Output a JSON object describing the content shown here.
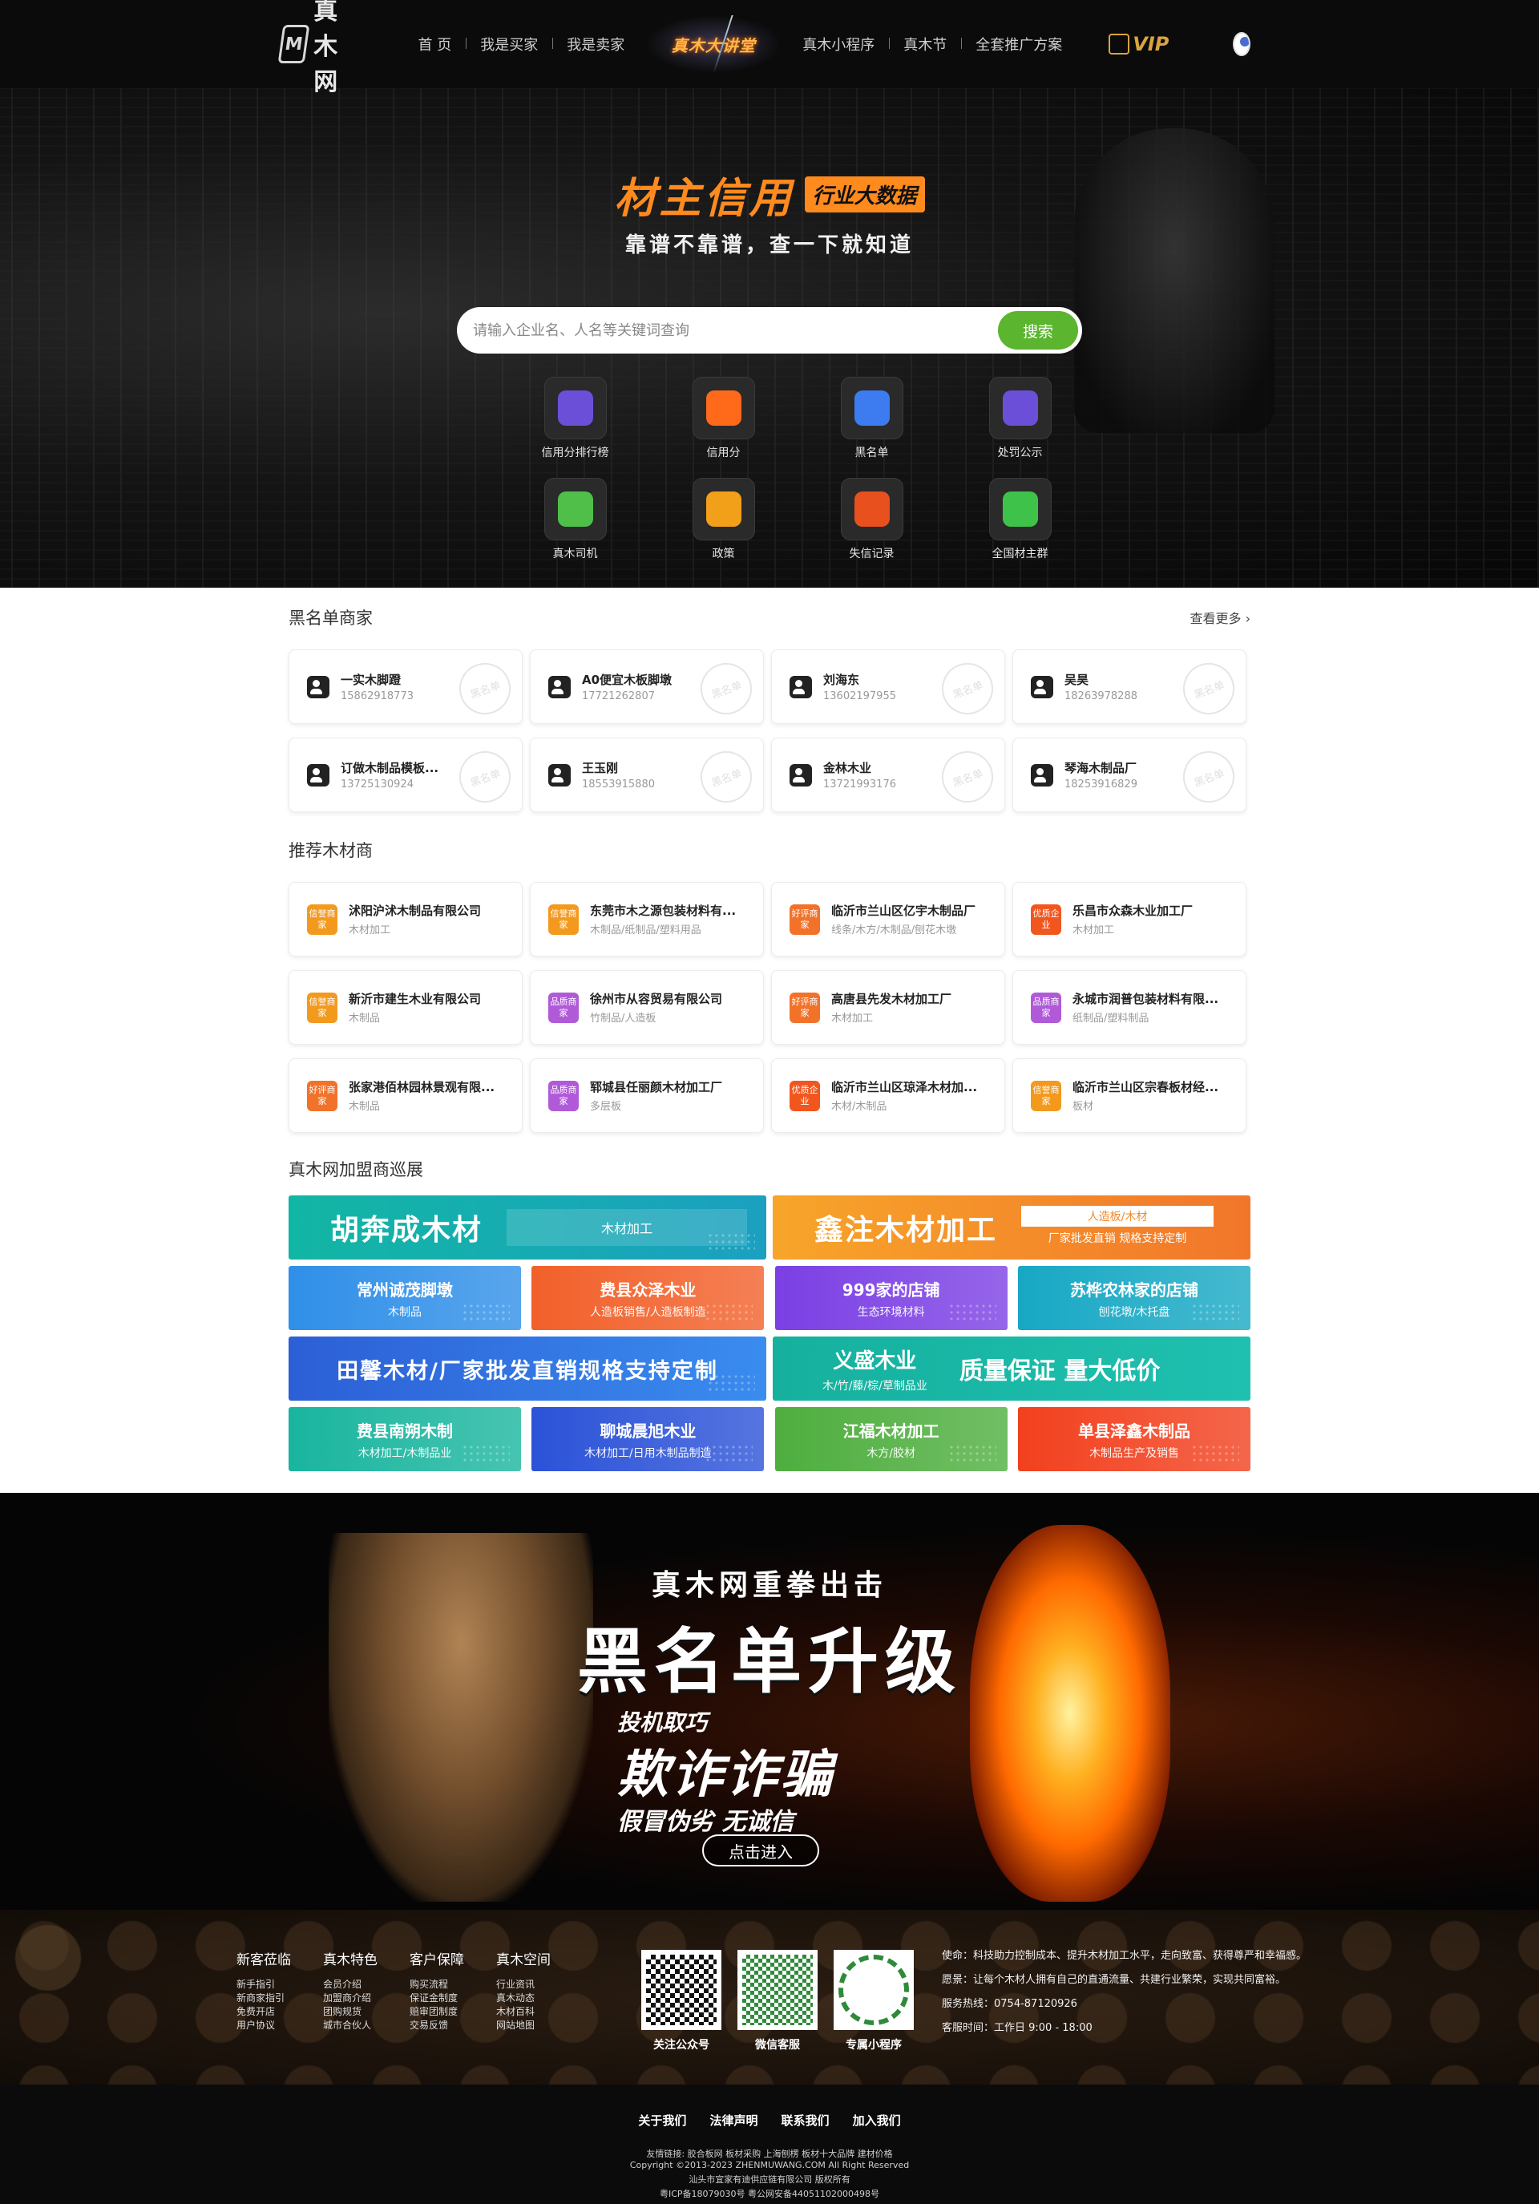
{
  "nav": {
    "logo_text": "真木网",
    "items": [
      "首 页",
      "我是买家",
      "我是卖家",
      "真木小程序",
      "真木节",
      "全套推广方案"
    ],
    "special_label": "真木大讲堂",
    "vip_label": "VIP"
  },
  "hero": {
    "title": "材主信用",
    "title_badge": "行业大数据",
    "subtitle": "靠谱不靠谱，查一下就知道",
    "search_placeholder": "请输入企业名、人名等关键词查询",
    "search_button": "搜索",
    "quick_links": [
      {
        "label": "信用分排行榜",
        "icon": "trophy-icon",
        "color": "#6b4fd8"
      },
      {
        "label": "信用分",
        "icon": "flower-badge-icon",
        "color": "#ff6a1a"
      },
      {
        "label": "黑名单",
        "icon": "user-block-icon",
        "color": "#3d7bf0"
      },
      {
        "label": "处罚公示",
        "icon": "notice-board-icon",
        "color": "#6b4fd8"
      },
      {
        "label": "真木司机",
        "icon": "driver-icon",
        "color": "#4fbf4a"
      },
      {
        "label": "政策",
        "icon": "policy-doc-icon",
        "color": "#f2a019"
      },
      {
        "label": "失信记录",
        "icon": "dishonest-record-icon",
        "color": "#e8501e"
      },
      {
        "label": "全国材主群",
        "icon": "wechat-group-icon",
        "color": "#3fc24a"
      }
    ]
  },
  "blacklist": {
    "title": "黑名单商家",
    "more": "查看更多",
    "stamp_text": "黑名单",
    "items": [
      {
        "name": "一实木脚蹬",
        "phone": "15862918773"
      },
      {
        "name": "A0便宜木板脚墩",
        "phone": "17721262807"
      },
      {
        "name": "刘海东",
        "phone": "13602197955"
      },
      {
        "name": "吴昊",
        "phone": "18263978288"
      },
      {
        "name": "订做木制品模板...",
        "phone": "13725130924"
      },
      {
        "name": "王玉刚",
        "phone": "18553915880"
      },
      {
        "name": "金林木业",
        "phone": "13721993176"
      },
      {
        "name": "琴海木制品厂",
        "phone": "18253916829"
      }
    ]
  },
  "recommend": {
    "title": "推荐木材商",
    "items": [
      {
        "badge": "信誉商家",
        "badge_color": "#f39a1e",
        "name": "沭阳沪沭木制品有限公司",
        "desc": "木材加工"
      },
      {
        "badge": "信誉商家",
        "badge_color": "#f39a1e",
        "name": "东莞市木之源包装材料有...",
        "desc": "木制品/纸制品/塑料用品"
      },
      {
        "badge": "好评商家",
        "badge_color": "#f2722a",
        "name": "临沂市兰山区亿宇木制品厂",
        "desc": "线条/木方/木制品/刨花木墩"
      },
      {
        "badge": "优质企业",
        "badge_color": "#f2561f",
        "name": "乐昌市众森木业加工厂",
        "desc": "木材加工"
      },
      {
        "badge": "信誉商家",
        "badge_color": "#f39a1e",
        "name": "新沂市建生木业有限公司",
        "desc": "木制品"
      },
      {
        "badge": "品质商家",
        "badge_color": "#b05ad8",
        "name": "徐州市从容贸易有限公司",
        "desc": "竹制品/人造板"
      },
      {
        "badge": "好评商家",
        "badge_color": "#f2722a",
        "name": "高唐县先发木材加工厂",
        "desc": "木材加工"
      },
      {
        "badge": "品质商家",
        "badge_color": "#b05ad8",
        "name": "永城市润普包装材料有限...",
        "desc": "纸制品/塑料制品"
      },
      {
        "badge": "好评商家",
        "badge_color": "#f2722a",
        "name": "张家港佰林园林景观有限...",
        "desc": "木制品"
      },
      {
        "badge": "品质商家",
        "badge_color": "#b05ad8",
        "name": "郓城县任丽颜木材加工厂",
        "desc": "多层板"
      },
      {
        "badge": "优质企业",
        "badge_color": "#f2561f",
        "name": "临沂市兰山区琼泽木材加...",
        "desc": "木材/木制品"
      },
      {
        "badge": "信誉商家",
        "badge_color": "#f39a1e",
        "name": "临沂市兰山区宗春板材经...",
        "desc": "板材"
      }
    ]
  },
  "showcase": {
    "title": "真木网加盟商巡展",
    "row1": [
      {
        "title": "胡奔成木材",
        "tag": "木材加工",
        "color": "#17b3a6"
      },
      {
        "title": "鑫注木材加工",
        "tag_top": "人造板/木材",
        "tag_bottom": "厂家批发直销 规格支持定制",
        "color": "#f5952a"
      }
    ],
    "row2": [
      {
        "title": "常州诚茂脚墩",
        "sub": "木制品",
        "color": "#2f8fe8"
      },
      {
        "title": "费县众泽木业",
        "sub": "人造板销售/人造板制造",
        "color": "#f2602a"
      },
      {
        "title": "999家的店铺",
        "sub": "生态环境材料",
        "color": "#7b3fe4"
      },
      {
        "title": "苏桦农林家的店铺",
        "sub": "刨花墩/木托盘",
        "color": "#17a8c4"
      }
    ],
    "row3": [
      {
        "title": "田馨木材/厂家批发直销规格支持定制",
        "color": "#2f6fe0"
      },
      {
        "title": "义盛木业",
        "sub": "木/竹/藤/棕/草制品业",
        "slogan": "质量保证 量大低价",
        "color": "#14b5a4"
      }
    ],
    "row4": [
      {
        "title": "费县南朔木制",
        "sub": "木材加工/木制品业",
        "color": "#19b59e"
      },
      {
        "title": "聊城晨旭木业",
        "sub": "木材加工/日用木制品制造",
        "color": "#2b52d8"
      },
      {
        "title": "江福木材加工",
        "sub": "木方/胶材",
        "color": "#4eae3e"
      },
      {
        "title": "单县泽鑫木制品",
        "sub": "木制品生产及销售",
        "color": "#f2401e"
      }
    ]
  },
  "promo": {
    "line1": "真木网重拳出击",
    "line2": "黑名单升级",
    "line3": "投机取巧",
    "line4": "欺诈诈骗",
    "line5": "假冒伪劣 无诚信",
    "button": "点击进入"
  },
  "footer": {
    "columns": [
      {
        "title": "新客莅临",
        "links": [
          "新手指引",
          "新商家指引",
          "免费开店",
          "用户协议"
        ]
      },
      {
        "title": "真木特色",
        "links": [
          "会员介绍",
          "加盟商介绍",
          "团购规货",
          "城市合伙人"
        ]
      },
      {
        "title": "客户保障",
        "links": [
          "购买流程",
          "保证金制度",
          "赔审团制度",
          "交易反馈"
        ]
      },
      {
        "title": "真木空间",
        "links": [
          "行业资讯",
          "真木动态",
          "木材百科",
          "网站地图"
        ]
      }
    ],
    "qrcodes": [
      {
        "label": "关注公众号"
      },
      {
        "label": "微信客服"
      },
      {
        "label": "专属小程序"
      }
    ],
    "mission": "使命：科技助力控制成本、提升木材加工水平，走向致富、获得尊严和幸福感。",
    "vision": "愿景：让每个木材人拥有自己的直通流量、共建行业繁荣，实现共同富裕。",
    "hotline": "服务热线：0754-87120926",
    "service_time": "客服时间：工作日 9:00 - 18:00",
    "bottom_links": [
      "关于我们",
      "法律声明",
      "联系我们",
      "加入我们"
    ],
    "friend_links": "友情链接: 胶合板网  板材采购  上海刨楞  板材十大品牌  建材价格",
    "copyright": "Copyright ©2013-2023 ZHENMUWANG.COM All Right Reserved",
    "company": "汕头市宜家有迪供应链有限公司 版权所有",
    "icp": "粤ICP备18079030号  粤公网安备44051102000498号"
  }
}
